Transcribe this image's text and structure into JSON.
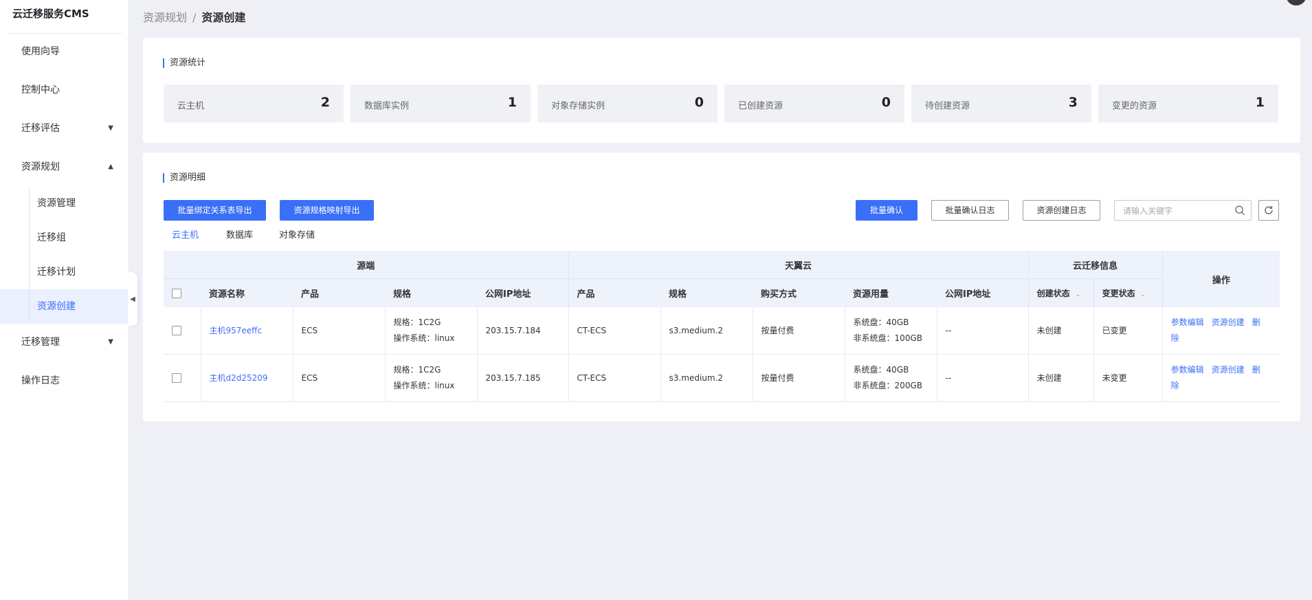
{
  "sidebar": {
    "brand": "云迁移服务CMS",
    "items": [
      {
        "label": "使用向导"
      },
      {
        "label": "控制中心"
      },
      {
        "label": "迁移评估"
      },
      {
        "label": "资源规划"
      },
      {
        "label": "迁移管理"
      },
      {
        "label": "操作日志"
      }
    ],
    "sub_items": [
      {
        "label": "资源管理"
      },
      {
        "label": "迁移组"
      },
      {
        "label": "迁移计划"
      },
      {
        "label": "资源创建"
      }
    ]
  },
  "breadcrumb": {
    "parent": "资源规划",
    "separator": "/",
    "current": "资源创建"
  },
  "stats_section": {
    "title": "资源统计",
    "stats": [
      {
        "label": "云主机",
        "value": "2"
      },
      {
        "label": "数据库实例",
        "value": "1"
      },
      {
        "label": "对象存储实例",
        "value": "0"
      },
      {
        "label": "已创建资源",
        "value": "0"
      },
      {
        "label": "待创建资源",
        "value": "3"
      },
      {
        "label": "变更的资源",
        "value": "1"
      }
    ]
  },
  "detail_section": {
    "title": "资源明细",
    "buttons": {
      "export_binding": "批量绑定关系表导出",
      "export_spec": "资源规格映射导出",
      "batch_confirm": "批量确认",
      "batch_log": "批量确认日志",
      "create_log": "资源创建日志"
    },
    "search": {
      "placeholder": "请输入关键字"
    },
    "tabs": [
      "云主机",
      "数据库",
      "对象存储"
    ],
    "active_tab": "云主机",
    "table": {
      "groups": {
        "source": "源端",
        "target": "天翼云",
        "cms": "云迁移信息",
        "ops": "操作"
      },
      "columns": {
        "name": "资源名称",
        "product": "产品",
        "spec": "规格",
        "ip": "公网IP地址",
        "t_product": "产品",
        "t_spec": "规格",
        "purchase": "购买方式",
        "usage": "资源用量",
        "t_ip": "公网IP地址",
        "create_status": "创建状态",
        "change_status": "变更状态"
      },
      "rows": [
        {
          "name": "主机957eeffc",
          "product": "ECS",
          "spec_line1": "规格：1C2G",
          "spec_line2": "操作系统：linux",
          "ip": "203.15.7.184",
          "t_product": "CT-ECS",
          "t_spec": "s3.medium.2",
          "purchase": "按量付费",
          "usage_line1": "系统盘：40GB",
          "usage_line2": "非系统盘：100GB",
          "t_ip": "--",
          "create_status": "未创建",
          "change_status": "已变更",
          "ops": [
            "参数编辑",
            "资源创建",
            "删除"
          ]
        },
        {
          "name": "主机d2d25209",
          "product": "ECS",
          "spec_line1": "规格：1C2G",
          "spec_line2": "操作系统：linux",
          "ip": "203.15.7.185",
          "t_product": "CT-ECS",
          "t_spec": "s3.medium.2",
          "purchase": "按量付费",
          "usage_line1": "系统盘：40GB",
          "usage_line2": "非系统盘：200GB",
          "t_ip": "--",
          "create_status": "未创建",
          "change_status": "未变更",
          "ops": [
            "参数编辑",
            "资源创建",
            "删除"
          ]
        }
      ]
    }
  },
  "colors": {
    "accent": "#3a6ff7",
    "page_bg": "#eff0f5",
    "header_bg": "#eef2fb"
  }
}
